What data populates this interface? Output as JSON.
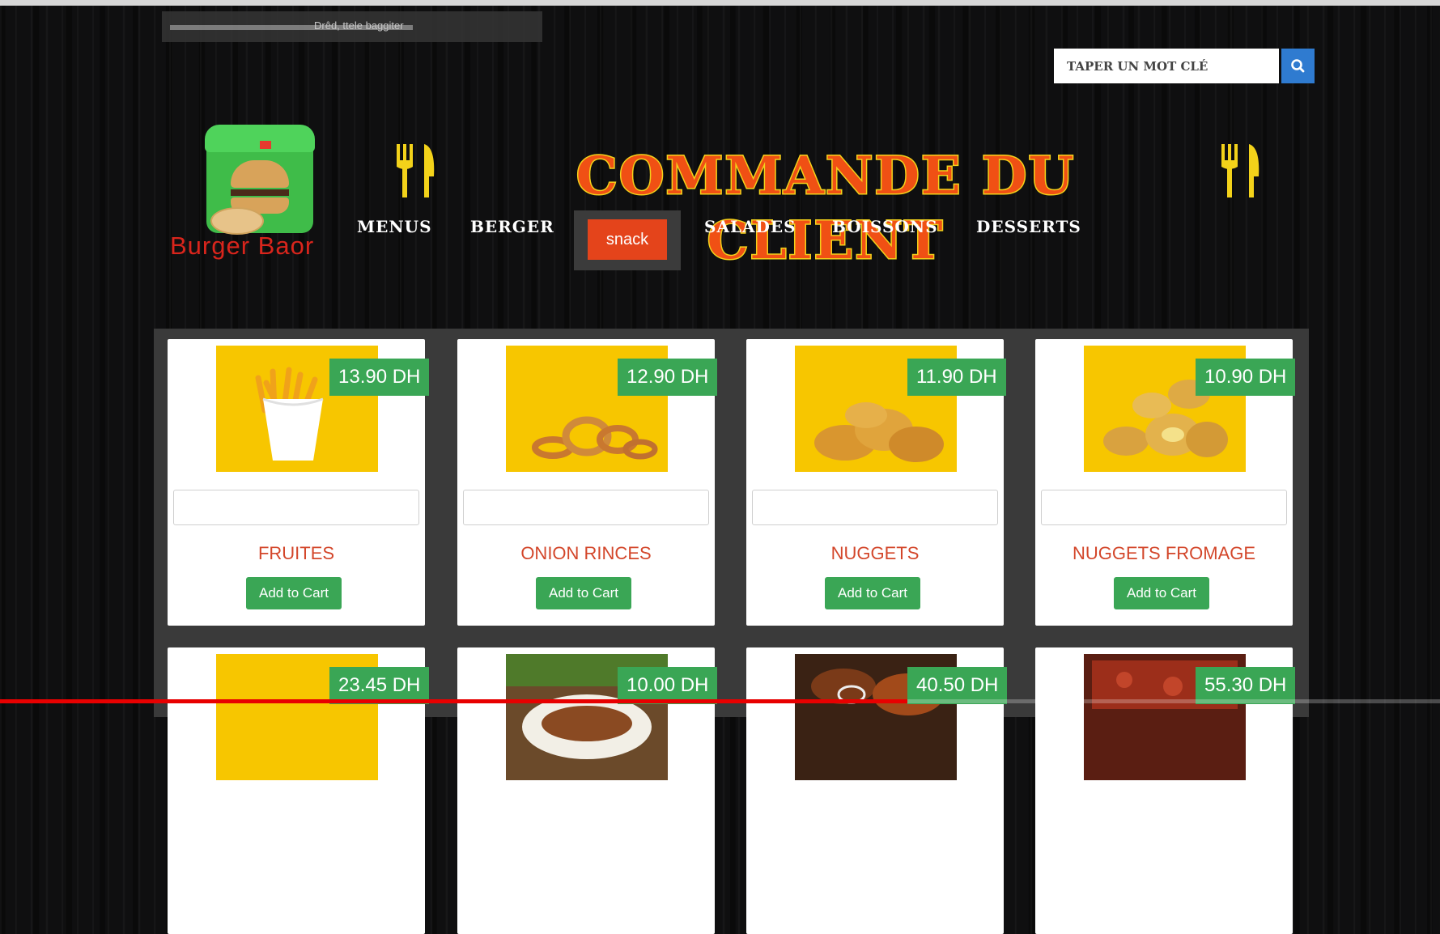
{
  "top_bar": {
    "text": "Drêd, ttele baggiter"
  },
  "search": {
    "placeholder": "TAPER UN MOT CLÉ",
    "icon": "search-icon"
  },
  "logo": {
    "brand": "Burger Baor"
  },
  "header": {
    "title": "COMMANDE DU CLIENT",
    "title_color": "#f05014",
    "outline_color": "#f3d21a"
  },
  "nav": {
    "items": [
      {
        "label": "MENUS"
      },
      {
        "label": "BERGER"
      },
      {
        "label": "snack",
        "active": true
      },
      {
        "label": "SALADES"
      },
      {
        "label": "BOISSONS"
      },
      {
        "label": "DESSERTS"
      }
    ]
  },
  "products": [
    {
      "price": "13.90 DH",
      "name": "FRUITES",
      "cart_label": "Add to Cart",
      "image": "fries"
    },
    {
      "price": "12.90 DH",
      "name": "ONION RINCES",
      "cart_label": "Add to Cart",
      "image": "onion-rings"
    },
    {
      "price": "11.90 DH",
      "name": "NUGGETS",
      "cart_label": "Add to Cart",
      "image": "nuggets"
    },
    {
      "price": "10.90 DH",
      "name": "NUGGETS FROMAGE",
      "cart_label": "Add to Cart",
      "image": "cheese-nuggets"
    },
    {
      "price": "23.45 DH",
      "image": "yellow-food"
    },
    {
      "price": "10.00 DH",
      "image": "salad-dish"
    },
    {
      "price": "40.50 DH",
      "image": "grill-dish"
    },
    {
      "price": "55.30 DH",
      "image": "pizza-dish"
    }
  ],
  "colors": {
    "accent_green": "#3aa655",
    "active_orange": "#e4441b",
    "search_blue": "#2f7bd0",
    "product_name": "#d3462a"
  },
  "video_progress": 0.63
}
